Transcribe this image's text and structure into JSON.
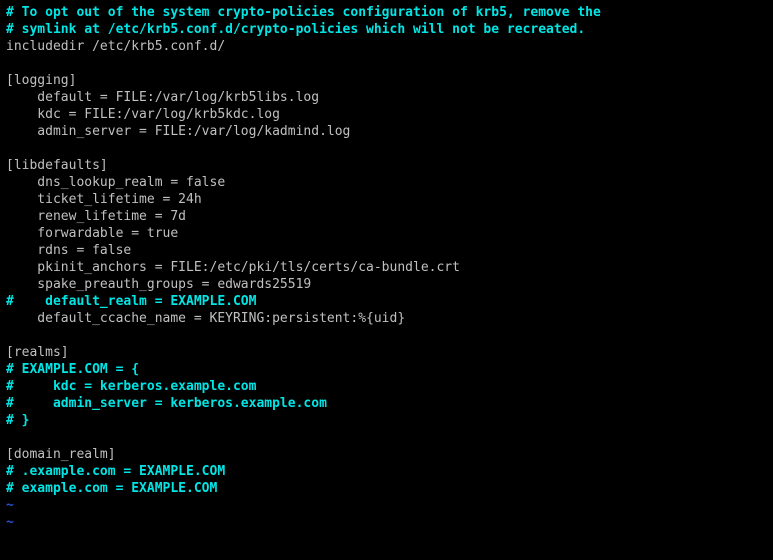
{
  "lines": [
    {
      "cls": "cyan",
      "text": "# To opt out of the system crypto-policies configuration of krb5, remove the"
    },
    {
      "cls": "cyan",
      "text": "# symlink at /etc/krb5.conf.d/crypto-policies which will not be recreated."
    },
    {
      "cls": "gray",
      "text": "includedir /etc/krb5.conf.d/"
    },
    {
      "cls": "gray",
      "text": ""
    },
    {
      "cls": "gray",
      "text": "[logging]"
    },
    {
      "cls": "gray",
      "text": "    default = FILE:/var/log/krb5libs.log"
    },
    {
      "cls": "gray",
      "text": "    kdc = FILE:/var/log/krb5kdc.log"
    },
    {
      "cls": "gray",
      "text": "    admin_server = FILE:/var/log/kadmind.log"
    },
    {
      "cls": "gray",
      "text": ""
    },
    {
      "cls": "gray",
      "text": "[libdefaults]"
    },
    {
      "cls": "gray",
      "text": "    dns_lookup_realm = false"
    },
    {
      "cls": "gray",
      "text": "    ticket_lifetime = 24h"
    },
    {
      "cls": "gray",
      "text": "    renew_lifetime = 7d"
    },
    {
      "cls": "gray",
      "text": "    forwardable = true"
    },
    {
      "cls": "gray",
      "text": "    rdns = false"
    },
    {
      "cls": "gray",
      "text": "    pkinit_anchors = FILE:/etc/pki/tls/certs/ca-bundle.crt"
    },
    {
      "cls": "gray",
      "text": "    spake_preauth_groups = edwards25519"
    },
    {
      "cls": "cyan",
      "text": "#    default_realm = EXAMPLE.COM"
    },
    {
      "cls": "gray",
      "text": "    default_ccache_name = KEYRING:persistent:%{uid}"
    },
    {
      "cls": "gray",
      "text": ""
    },
    {
      "cls": "gray",
      "text": "[realms]"
    },
    {
      "cls": "cyan",
      "text": "# EXAMPLE.COM = {"
    },
    {
      "cls": "cyan",
      "text": "#     kdc = kerberos.example.com"
    },
    {
      "cls": "cyan",
      "text": "#     admin_server = kerberos.example.com"
    },
    {
      "cls": "cyan",
      "text": "# }"
    },
    {
      "cls": "gray",
      "text": ""
    },
    {
      "cls": "gray",
      "text": "[domain_realm]"
    },
    {
      "cls": "cyan",
      "text": "# .example.com = EXAMPLE.COM"
    },
    {
      "cls": "cyan",
      "text": "# example.com = EXAMPLE.COM"
    },
    {
      "cls": "endtilde",
      "text": "~"
    },
    {
      "cls": "endtilde",
      "text": "~"
    }
  ]
}
